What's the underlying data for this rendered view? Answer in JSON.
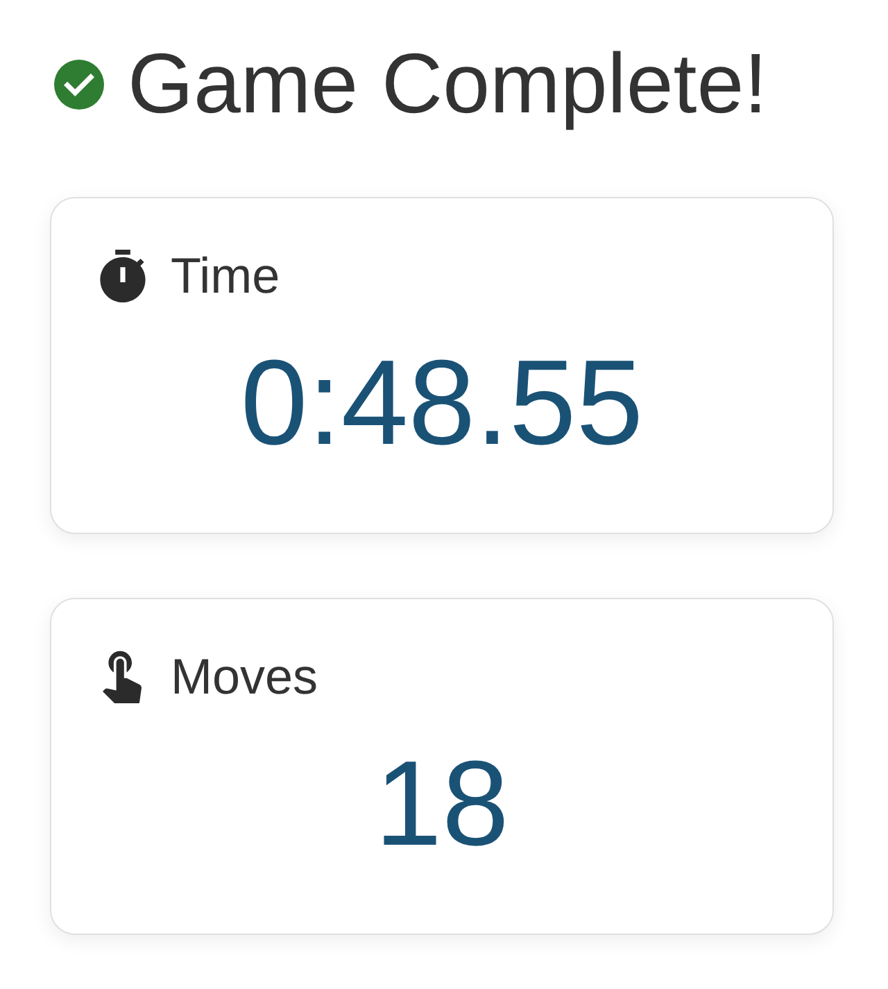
{
  "header": {
    "title": "Game Complete!"
  },
  "stats": [
    {
      "kind": "time",
      "label": "Time",
      "value": "0:48.55"
    },
    {
      "kind": "moves",
      "label": "Moves",
      "value": "18"
    }
  ]
}
